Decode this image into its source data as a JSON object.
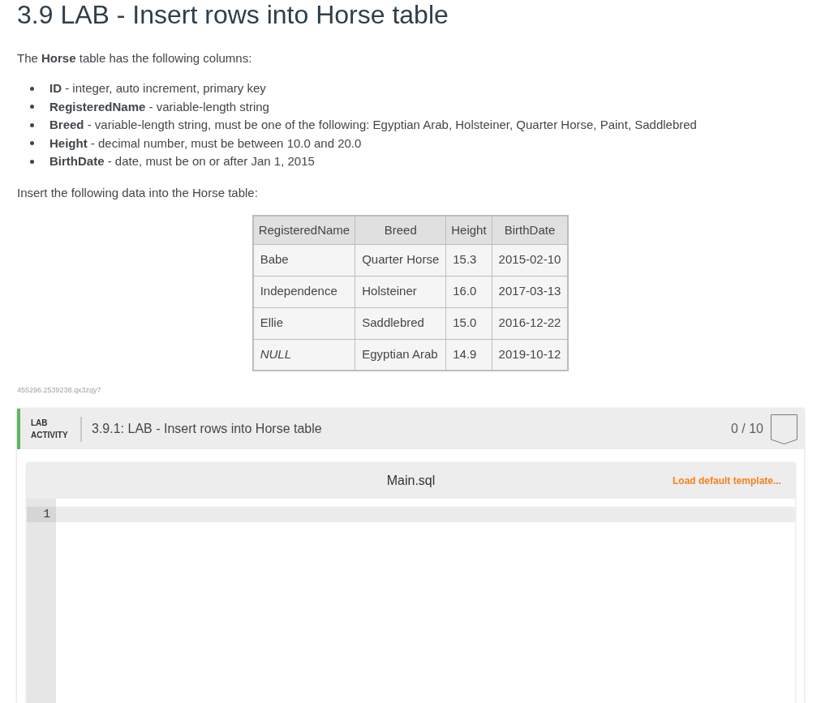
{
  "title": "3.9 LAB - Insert rows into Horse table",
  "intro": "The **Horse** table has the following columns:",
  "column_definitions": [
    "**ID** - integer, auto increment, primary key",
    "**RegisteredName** - variable-length string",
    "**Breed** - variable-length string, must be one of the following: Egyptian Arab, Holsteiner, Quarter Horse, Paint, Saddlebred",
    "**Height** - decimal number, must be between 10.0 and 20.0",
    "**BirthDate** - date, must be on or after Jan 1, 2015"
  ],
  "instruction": "Insert the following data into the Horse table:",
  "data_table": {
    "columns": [
      "RegisteredName",
      "Breed",
      "Height",
      "BirthDate"
    ],
    "rows": [
      {
        "cells": [
          {
            "text": "Babe",
            "italic": false
          },
          {
            "text": "Quarter Horse",
            "italic": false
          },
          {
            "text": "15.3",
            "italic": false
          },
          {
            "text": "2015-02-10",
            "italic": false
          }
        ]
      },
      {
        "cells": [
          {
            "text": "Independence",
            "italic": false
          },
          {
            "text": "Holsteiner",
            "italic": false
          },
          {
            "text": "16.0",
            "italic": false
          },
          {
            "text": "2017-03-13",
            "italic": false
          }
        ]
      },
      {
        "cells": [
          {
            "text": "Ellie",
            "italic": false
          },
          {
            "text": "Saddlebred",
            "italic": false
          },
          {
            "text": "15.0",
            "italic": false
          },
          {
            "text": "2016-12-22",
            "italic": false
          }
        ]
      },
      {
        "cells": [
          {
            "text": "NULL",
            "italic": true
          },
          {
            "text": "Egyptian Arab",
            "italic": false
          },
          {
            "text": "14.9",
            "italic": false
          },
          {
            "text": "2019-10-12",
            "italic": false
          }
        ]
      }
    ]
  },
  "identifier": "455296.2539238.qx3zqy7",
  "lab_activity": {
    "label": "LAB ACTIVITY",
    "title": "3.9.1: LAB - Insert rows into Horse table",
    "score": "0 / 10",
    "editor": {
      "filename": "Main.sql",
      "template_link": "Load default template...",
      "lines": [
        {
          "number": "1",
          "active": true
        }
      ]
    }
  }
}
